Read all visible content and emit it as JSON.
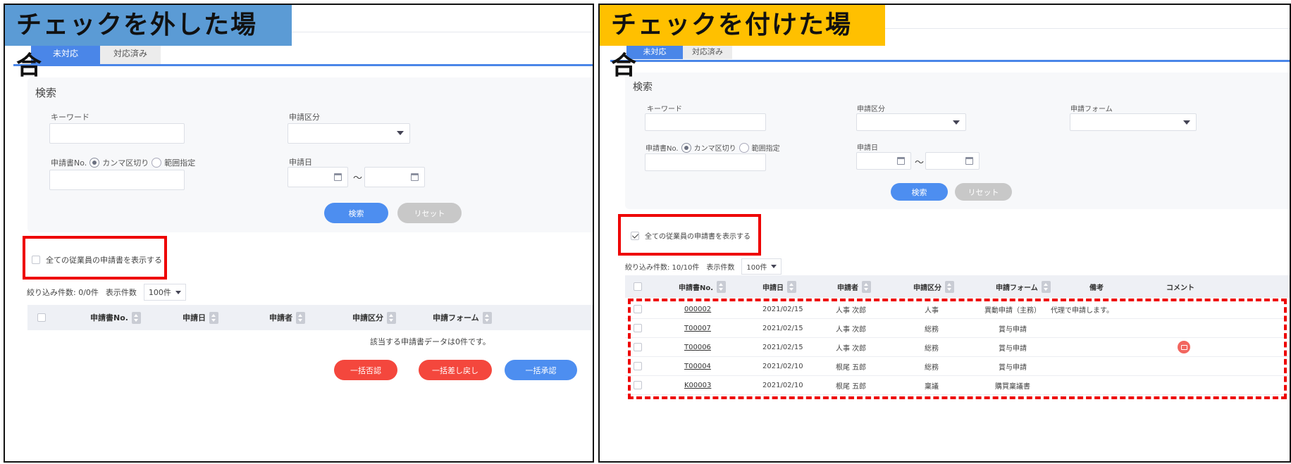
{
  "left": {
    "banner": "チェックを外した場合",
    "tabs": [
      "未対応",
      "対応済み"
    ],
    "search": {
      "title": "検索",
      "keyword_label": "キーワード",
      "category_label": "申請区分",
      "appno_label": "申請書No.",
      "radio_comma": "カンマ区切り",
      "radio_range": "範囲指定",
      "date_label": "申請日",
      "tilde": "～",
      "search_button": "検索",
      "reset_button": "リセット"
    },
    "show_all_label": "全ての従業員の申請書を表示する",
    "show_all_checked": false,
    "filter_count": "絞り込み件数: 0/0件",
    "page_size_label": "表示件数",
    "page_size": "100件",
    "columns": [
      "申請書No.",
      "申請日",
      "申請者",
      "申請区分",
      "申請フォーム"
    ],
    "empty_message": "該当する申請書データは0件です。",
    "actions": [
      "一括否認",
      "一括差し戻し",
      "一括承認"
    ]
  },
  "right": {
    "banner": "チェックを付けた場合",
    "tabs": [
      "未対応",
      "対応済み"
    ],
    "search": {
      "title": "検索",
      "keyword_label": "キーワード",
      "category_label": "申請区分",
      "form_label": "申請フォーム",
      "appno_label": "申請書No.",
      "radio_comma": "カンマ区切り",
      "radio_range": "範囲指定",
      "date_label": "申請日",
      "tilde": "～",
      "search_button": "検索",
      "reset_button": "リセット"
    },
    "show_all_label": "全ての従業員の申請書を表示する",
    "show_all_checked": true,
    "filter_count": "絞り込み件数: 10/10件",
    "page_size_label": "表示件数",
    "page_size": "100件",
    "columns": [
      "申請書No.",
      "申請日",
      "申請者",
      "申請区分",
      "申請フォーム",
      "備考",
      "コメント"
    ],
    "rows": [
      {
        "no": "000002",
        "date": "2021/02/15",
        "applicant": "人事 次郎",
        "category": "人事",
        "form": "異動申請（主務）",
        "note": "代理で申請します。",
        "comment": false
      },
      {
        "no": "T00007",
        "date": "2021/02/15",
        "applicant": "人事 次郎",
        "category": "総務",
        "form": "賞与申請",
        "note": "",
        "comment": false
      },
      {
        "no": "T00006",
        "date": "2021/02/15",
        "applicant": "人事 次郎",
        "category": "総務",
        "form": "賞与申請",
        "note": "",
        "comment": true
      },
      {
        "no": "T00004",
        "date": "2021/02/10",
        "applicant": "根尾 五郎",
        "category": "総務",
        "form": "賞与申請",
        "note": "",
        "comment": false
      },
      {
        "no": "K00003",
        "date": "2021/02/10",
        "applicant": "根尾 五郎",
        "category": "稟議",
        "form": "購買稟議書",
        "note": "",
        "comment": false
      }
    ]
  },
  "colors": {
    "accent_blue": "#4a86e8",
    "banner_blue": "#5b9bd5",
    "banner_yellow": "#ffc000",
    "highlight_red": "#e00000",
    "danger_red": "#f4473d"
  }
}
